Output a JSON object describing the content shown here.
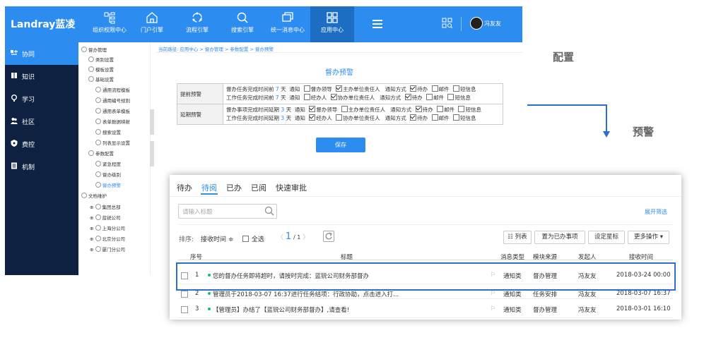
{
  "app": {
    "logo": "Landray蓝凌"
  },
  "nav": {
    "items": [
      {
        "label": "组织权限中心",
        "icon": "org-icon"
      },
      {
        "label": "门户引擎",
        "icon": "home-icon"
      },
      {
        "label": "流程引擎",
        "icon": "flow-icon"
      },
      {
        "label": "搜索引擎",
        "icon": "search-icon"
      },
      {
        "label": "统一消息中心",
        "icon": "message-icon"
      },
      {
        "label": "应用中心",
        "icon": "grid-icon"
      }
    ],
    "user": "冯友友"
  },
  "sidebar": {
    "items": [
      {
        "label": "协同",
        "icon": "collab-icon"
      },
      {
        "label": "知识",
        "icon": "book-icon"
      },
      {
        "label": "学习",
        "icon": "bulb-icon"
      },
      {
        "label": "社区",
        "icon": "people-icon"
      },
      {
        "label": "费控",
        "icon": "shield-icon"
      },
      {
        "label": "机制",
        "icon": "doc-icon"
      }
    ]
  },
  "tree": {
    "nodes": [
      "督办管理",
      "类别设置",
      "模板设置",
      "基础设置",
      "通用流程模板",
      "通用编号规则",
      "通用表单模板",
      "表单数据映射",
      "搜索设置",
      "列表显示设置",
      "参数配置",
      "紧急程度",
      "督办级别",
      "督办预警",
      "文档维护",
      "集团总部",
      "蓝锐公司",
      "上海分公司",
      "北京分公司",
      "厦门分公司"
    ]
  },
  "breadcrumb": "当前路径: 应用中心 > 督办管理 > 参数配置 > 督办预警",
  "panel": {
    "title": "督办预警",
    "rows": [
      {
        "header": "提前预警",
        "lines": [
          {
            "text": "督办任务完成时间前",
            "num": "7",
            "unit": "天",
            "notify": "通知",
            "opt1": "督办领导",
            "opt2": "主办单位责任人",
            "method": "通知方式",
            "m1": "待办",
            "m2": "邮件",
            "m3": "短信息"
          },
          {
            "text": "工作任务完成时间前",
            "num": "7",
            "unit": "天",
            "notify": "通知",
            "opt1": "经办人",
            "opt2": "协办单位责任人",
            "method": "通知方式",
            "m1": "待办",
            "m2": "邮件",
            "m3": "短信息"
          }
        ]
      },
      {
        "header": "延期预警",
        "lines": [
          {
            "text": "督办事项完成时间延期",
            "num": "3",
            "unit": "天",
            "notify": "通知",
            "opt1": "督办领导",
            "opt2": "主办单位责任人",
            "method": "通知方式",
            "m1": "待办",
            "m2": "邮件",
            "m3": "短信息"
          },
          {
            "text": "工作任务完成时间延期",
            "num": "3",
            "unit": "天",
            "notify": "通知",
            "opt1": "经办人",
            "opt2": "协办单位责任人",
            "method": "通知方式",
            "m1": "待办",
            "m2": "邮件",
            "m3": "短信息"
          }
        ]
      }
    ],
    "save": "保存"
  },
  "annotations": {
    "config": "配置",
    "warning": "预警"
  },
  "list": {
    "tabs": [
      "待办",
      "待阅",
      "已办",
      "已阅",
      "快速审批"
    ],
    "search_placeholder": "请输入标题",
    "expand_filter": "展开筛选",
    "sort_label": "排序:",
    "sort_value": "接收时间 ≑",
    "select_all": "全选",
    "page": "1",
    "page_total": "/ 1",
    "btn_list": "☷ 列表",
    "btn_mark": "置为已办事项",
    "btn_star": "设定星标",
    "btn_more": "更多操作 ▾",
    "headers": [
      "序号",
      "标题",
      "消息类型",
      "模块来源",
      "发起人",
      "接收时间"
    ],
    "rows": [
      {
        "no": "1",
        "title": "您的督办任务即将超时，请按时完成：蓝锐公司财务部督办",
        "type": "通知类",
        "module": "督办管理",
        "sender": "冯友友",
        "time": "2018-03-24 00:00"
      },
      {
        "no": "2",
        "title": "管理员于2018-03-07 16:37进行任务结项：行政协助，点击进入打...",
        "type": "通知类",
        "module": "任务安排",
        "sender": "冯友友",
        "time": "2018-03-07 16:37"
      },
      {
        "no": "3",
        "title": "【管理员】办结了【蓝锐公司财务部督办】,请查看!",
        "type": "通知类",
        "module": "督办管理",
        "sender": "冯友友",
        "time": "2018-03-01 16:10"
      }
    ]
  },
  "colors": {
    "accent": "#2d8cf0",
    "sidebar": "#0f2140",
    "highlight": "#2d6fd1",
    "dot": "#19be6b"
  }
}
